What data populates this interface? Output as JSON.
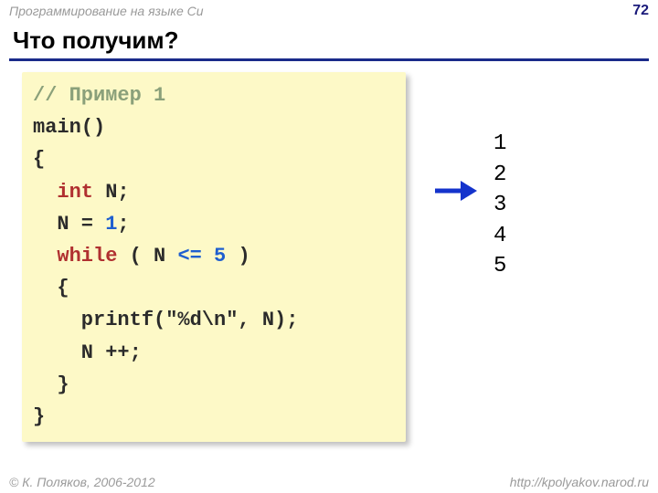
{
  "header": {
    "breadcrumb": "Программирование на языке Си",
    "page_number": "72"
  },
  "title": "Что получим?",
  "code": {
    "comment": "// Пример 1",
    "l1": "main()",
    "l2": "{",
    "l3a": "  ",
    "l3_kw": "int",
    "l3b": " N;",
    "l4a": "  N = ",
    "l4_num": "1",
    "l4b": ";",
    "l5a": "  ",
    "l5_kw": "while",
    "l5b": " ( N ",
    "l5_op": "<=",
    "l5c": " ",
    "l5_num": "5",
    "l5d": " )",
    "l6": "  {",
    "l7": "    printf(\"%d\\n\", N);",
    "l8": "    N ++;",
    "l9": "  }",
    "l10": "}"
  },
  "output": [
    "1",
    "2",
    "3",
    "4",
    "5"
  ],
  "footer": {
    "copyright": "© К. Поляков, 2006-2012",
    "url": "http://kpolyakov.narod.ru"
  }
}
